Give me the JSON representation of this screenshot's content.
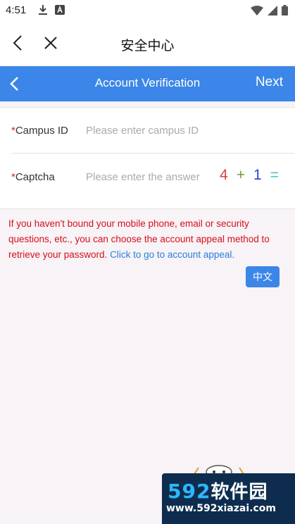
{
  "status_bar": {
    "time": "4:51",
    "left_icons": [
      "download-icon",
      "font-app-icon"
    ],
    "right_icons": [
      "wifi-icon",
      "signal-icon",
      "battery-icon"
    ]
  },
  "nav": {
    "title": "安全中心",
    "back_icon": "chevron-left-icon",
    "close_icon": "close-icon"
  },
  "header": {
    "title": "Account Verification",
    "next_label": "Next",
    "background": "#3b86e8"
  },
  "form": {
    "campus_id": {
      "required_mark": "*",
      "label": "Campus ID",
      "placeholder": "Please enter campus ID"
    },
    "captcha": {
      "required_mark": "*",
      "label": "Captcha",
      "placeholder": "Please enter the answer",
      "puzzle": [
        "4",
        "+",
        "1",
        "="
      ]
    }
  },
  "notice": {
    "text": "If you haven't bound your mobile phone, email or security questions, etc., you can choose the account appeal method to retrieve your password.",
    "link_text": "Click to go to account appeal.",
    "text_color": "#d60f1b",
    "link_color": "#2a7fe0"
  },
  "language_button": {
    "label": "中文"
  },
  "watermark": {
    "brand_number": "592",
    "brand_text": "软件园",
    "url": "www.592xiazai.com"
  }
}
